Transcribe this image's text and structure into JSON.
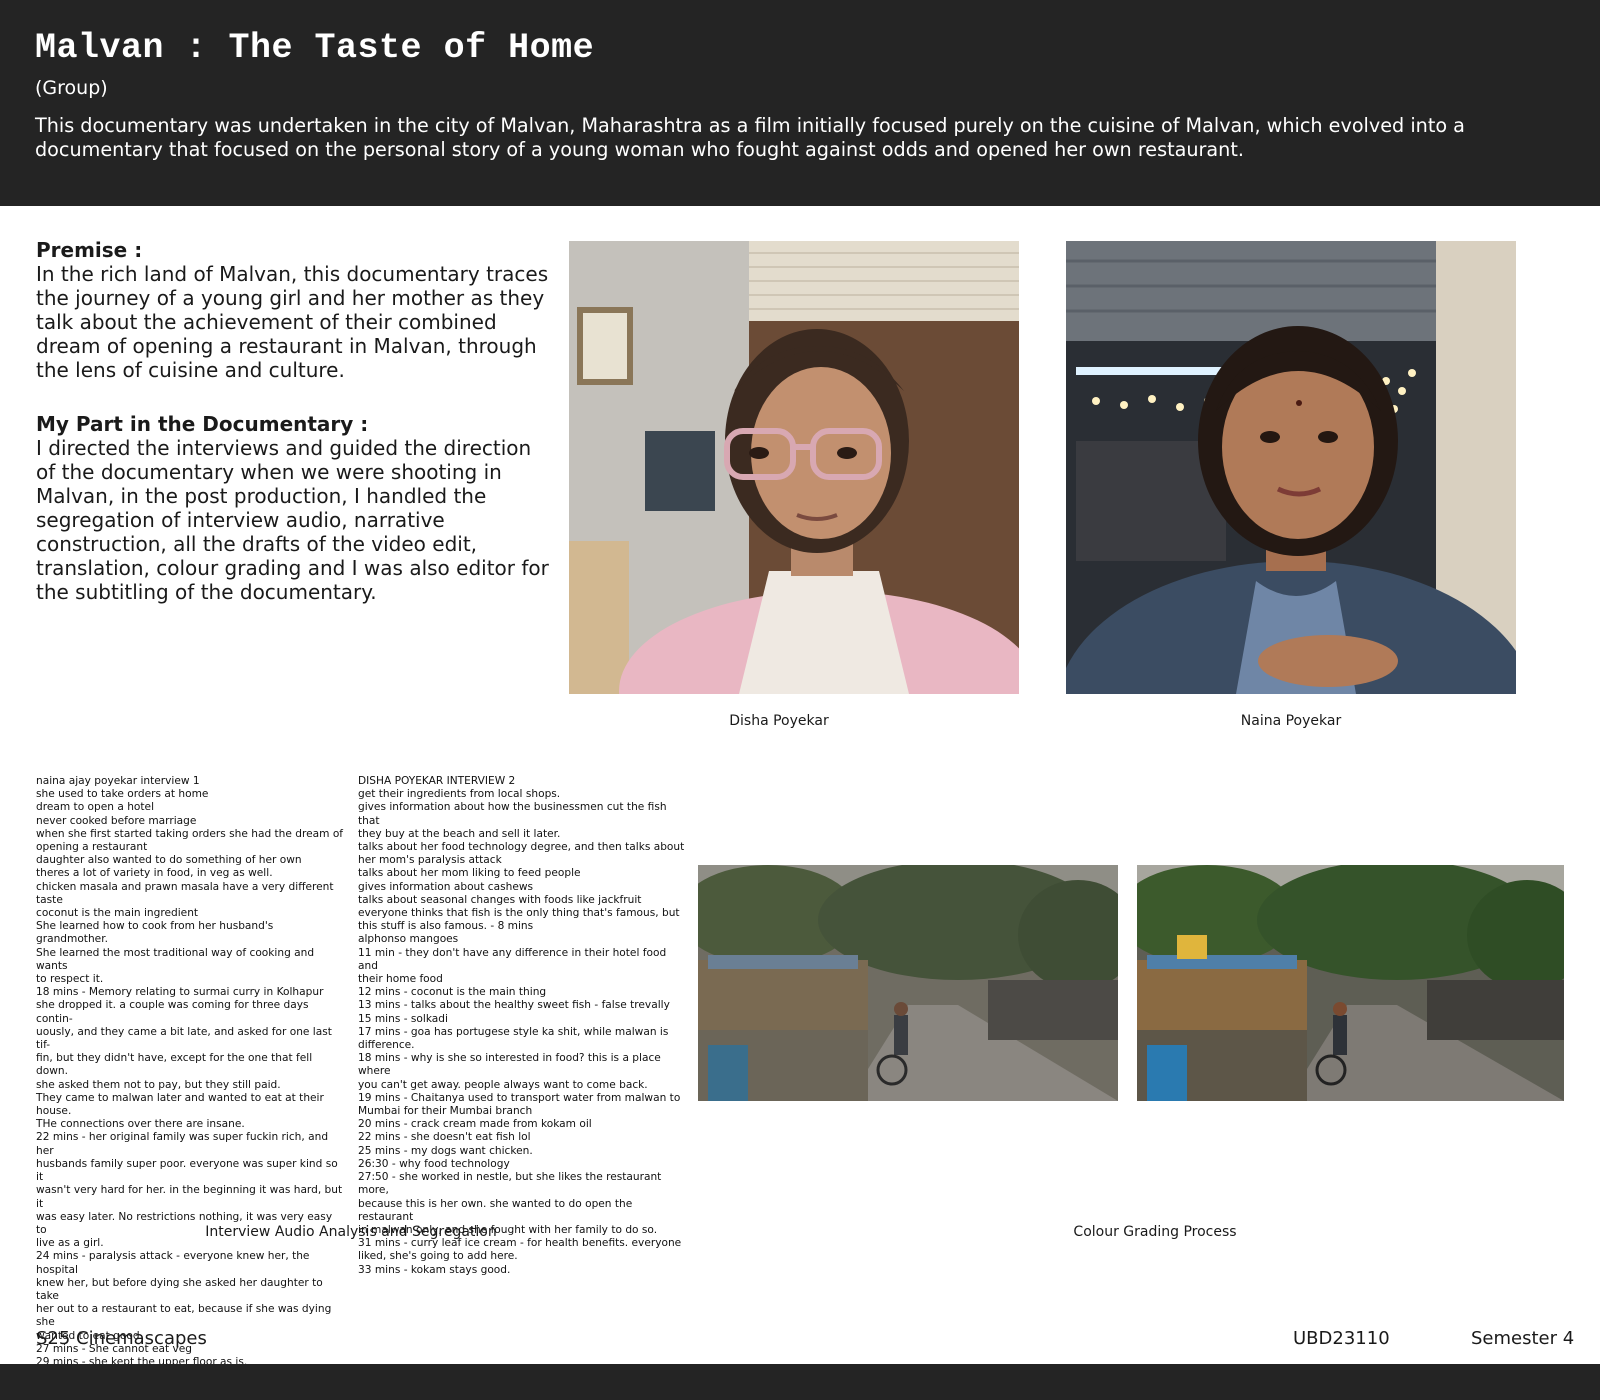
{
  "header": {
    "title": "Malvan : The Taste of Home",
    "subtitle": "(Group)",
    "description": "This documentary was undertaken in the city of Malvan, Maharashtra as a film initially focused purely on the cuisine of Malvan, which evolved into a documentary that focused on the personal story of a young woman who fought against odds and opened her own restaurant."
  },
  "premise": {
    "heading": "Premise :",
    "text": "In the rich land of Malvan, this documentary traces the journey of a young girl and her mother as they talk about the achievement of their combined dream of opening a restaurant in Malvan, through the lens of cuisine and culture."
  },
  "my_part": {
    "heading": "My Part in the Documentary :",
    "text": "I directed the interviews and guided the direction of the documentary when we were shooting in Malvan, in the post production, I handled the segregation of interview audio, narrative construction, all the drafts of the video edit, translation, colour grading and I was also editor for the subtitling of the documentary."
  },
  "portraits": {
    "disha_caption": "Disha Poyekar",
    "naina_caption": "Naina Poyekar"
  },
  "notes_1": [
    "naina ajay poyekar interview 1",
    "she used to take orders at home",
    "dream to open a hotel",
    "never cooked before marriage",
    "when she first started taking orders she had the dream of",
    "opening a restaurant",
    "daughter also wanted to do something of her own",
    "theres a lot of variety in food, in veg as well.",
    "chicken masala and prawn masala have a very different",
    "taste",
    "coconut is the main ingredient",
    "She learned how to cook from her husband's grandmother.",
    "She learned the most traditional way of cooking and wants",
    "to respect it.",
    "18 mins - Memory relating to surmai curry in Kolhapur",
    "she dropped it. a couple was coming for three days contin-",
    "uously, and they came a bit late, and asked for one last tif-",
    "fin, but they didn't have, except for the one that fell down.",
    "she asked them not to pay, but they still paid.",
    "They came to malwan later and wanted to eat at their",
    "house.",
    "THe connections over there are insane.",
    "22 mins - her original family was super fuckin rich, and her",
    "husbands family super poor. everyone was super kind so it",
    "wasn't very hard for her. in the beginning it was hard, but it",
    "was easy later. No restrictions nothing, it was very easy to",
    "live as a girl.",
    "24 mins - paralysis attack - everyone knew her, the hospital",
    "knew her, but before dying she asked her daughter to take",
    "her out to a restaurant to eat, because if she was dying she",
    "wanted to eat good.",
    "27 mins - She cannot eat veg",
    "29 mins - she kept the upper floor as is."
  ],
  "notes_2": [
    "DISHA POYEKAR INTERVIEW 2",
    "get their ingredients from local shops.",
    "gives information about how the businessmen cut the fish that",
    "they buy at the beach and sell it later.",
    "talks about her food technology degree, and then talks about",
    "her mom's paralysis attack",
    "talks about her mom liking to feed people",
    "gives information about cashews",
    "talks about seasonal changes with foods like jackfruit",
    "everyone thinks that fish is the only thing that's famous, but",
    "this stuff is also famous. - 8 mins",
    "alphonso mangoes",
    "11 min - they don't have any difference in their hotel food and",
    "their home food",
    "12 mins - coconut is the main thing",
    "13 mins - talks about the healthy sweet fish - false trevally",
    "15 mins - solkadi",
    "17 mins - goa has portugese style ka shit, while malwan is",
    "difference.",
    "18 mins - why is she so interested in food? this is a place where",
    "you can't get away. people always want to come back.",
    "19 mins - Chaitanya used to transport water from malwan to",
    "Mumbai for their Mumbai branch",
    "20 mins - crack cream made from kokam oil",
    "22 mins - she doesn't eat fish lol",
    "25 mins - my dogs want chicken.",
    "26:30 - why food technology",
    "27:50 - she worked in nestle, but she likes the restaurant more,",
    "because this is her own. she wanted to do open the restaurant",
    "in malwan only, and she fought with her family to do so.",
    "31 mins - curry leaf ice cream - for health benefits. everyone",
    "liked, she's going to add here.",
    "33 mins - kokam stays good."
  ],
  "captions": {
    "audio": "Interview Audio Analysis and Segregation",
    "grading": "Colour Grading Process"
  },
  "footer": {
    "course": "S25 Cinemascapes",
    "id": "UBD23110",
    "semester": "Semester 4"
  }
}
